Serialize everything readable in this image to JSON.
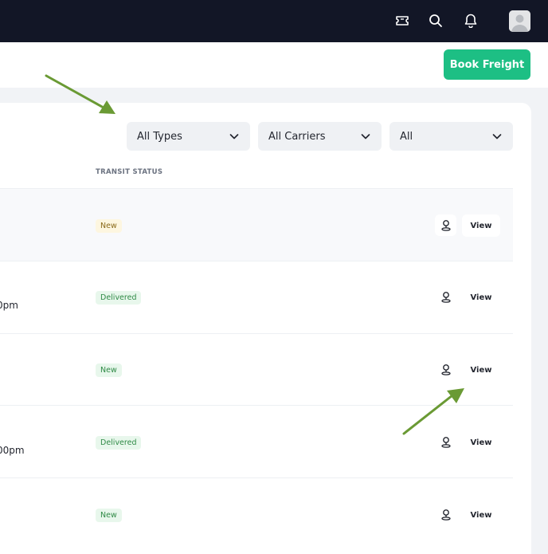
{
  "header": {
    "icons": [
      "ticket-icon",
      "search-icon",
      "bell-icon",
      "avatar"
    ]
  },
  "toolbar": {
    "book_freight_label": "Book Freight"
  },
  "filters": {
    "types": "All Types",
    "carriers": "All Carriers",
    "status": "All"
  },
  "table": {
    "columns": [
      "TRANSIT STATUS"
    ],
    "rows": [
      {
        "partial_text": "",
        "status": "New",
        "view_label": "View"
      },
      {
        "partial_text": "0pm",
        "status": "Delivered",
        "view_label": "View"
      },
      {
        "partial_text": "",
        "status": "New",
        "view_label": "View"
      },
      {
        "partial_text": "00pm",
        "status": "Delivered",
        "view_label": "View"
      },
      {
        "partial_text": "",
        "status": "New",
        "view_label": "View"
      }
    ]
  },
  "colors": {
    "topbar": "#121626",
    "accent": "#1dbf84",
    "annotation_arrow": "#6a9a34"
  }
}
